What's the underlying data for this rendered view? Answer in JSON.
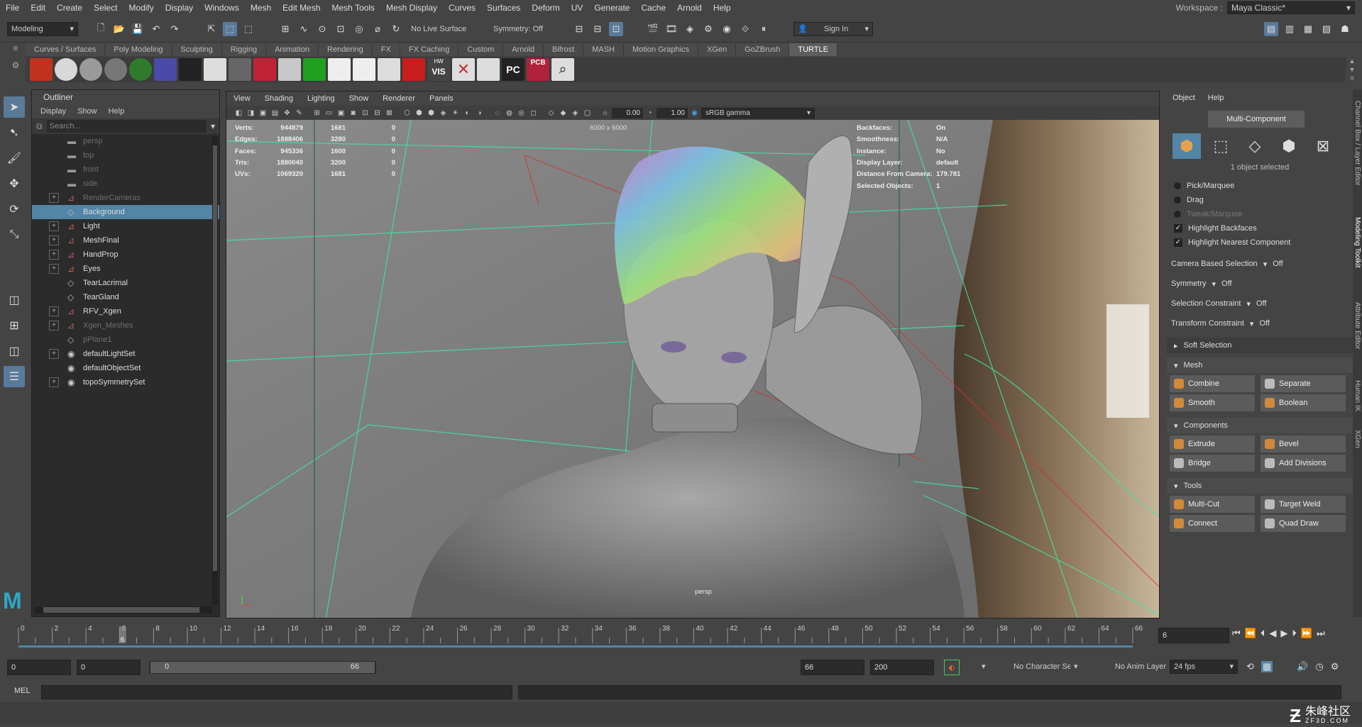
{
  "menubar": {
    "items": [
      "File",
      "Edit",
      "Create",
      "Select",
      "Modify",
      "Display",
      "Windows",
      "Mesh",
      "Edit Mesh",
      "Mesh Tools",
      "Mesh Display",
      "Curves",
      "Surfaces",
      "Deform",
      "UV",
      "Generate",
      "Cache",
      "Arnold",
      "Help"
    ]
  },
  "workspace": {
    "label": "Workspace :",
    "value": "Maya Classic*"
  },
  "statusline": {
    "mode": "Modeling",
    "live_surface": "No Live Surface",
    "symmetry": "Symmetry: Off",
    "sign_in": "Sign In"
  },
  "shelf": {
    "tabs": [
      "Curves / Surfaces",
      "Poly Modeling",
      "Sculpting",
      "Rigging",
      "Animation",
      "Rendering",
      "FX",
      "FX Caching",
      "Custom",
      "Arnold",
      "Bifrost",
      "MASH",
      "Motion Graphics",
      "XGen",
      "GoZBrush",
      "TURTLE"
    ],
    "active_tab": "TURTLE",
    "icons": [
      {
        "name": "fire",
        "color": "#c0321d"
      },
      {
        "name": "sphere-white",
        "color": "#d8d8d8"
      },
      {
        "name": "sphere-grey",
        "color": "#9a9a9a"
      },
      {
        "name": "sphere-dark",
        "color": "#777"
      },
      {
        "name": "sphere-green",
        "color": "#2e7b2e"
      },
      {
        "name": "grid-blue",
        "color": "#4a4aa8"
      },
      {
        "name": "dots",
        "color": "#222"
      },
      {
        "name": "molecule",
        "color": "#ddd"
      },
      {
        "name": "cylinder",
        "color": "#666"
      },
      {
        "name": "red-square",
        "color": "#c02236"
      },
      {
        "name": "red-cube",
        "color": "#c8c8c8"
      },
      {
        "name": "green-ball",
        "color": "#1fa01f"
      },
      {
        "name": "white-shapes",
        "color": "#eee"
      },
      {
        "name": "white-blob",
        "color": "#eee"
      },
      {
        "name": "lens",
        "color": "#ddd"
      },
      {
        "name": "red-eye",
        "color": "#c81e1e"
      },
      {
        "name": "hw-vis",
        "color": "#444"
      },
      {
        "name": "red-x",
        "color": "#d03030"
      },
      {
        "name": "bars",
        "color": "#ddd"
      },
      {
        "name": "pc",
        "color": "#222"
      },
      {
        "name": "pcb",
        "color": "#b0223a"
      },
      {
        "name": "magnifier",
        "color": "#ddd"
      }
    ],
    "hw_label": "HW",
    "vis_label": "VIS",
    "pc_label": "PC",
    "pcb_label": "PCB"
  },
  "outliner": {
    "title": "Outliner",
    "menu": [
      "Display",
      "Show",
      "Help"
    ],
    "search_placeholder": "Search...",
    "rows": [
      {
        "label": "persp",
        "exp": false,
        "icon": "camera",
        "dim": true,
        "sel": false
      },
      {
        "label": "top",
        "exp": false,
        "icon": "camera",
        "dim": true,
        "sel": false
      },
      {
        "label": "front",
        "exp": false,
        "icon": "camera",
        "dim": true,
        "sel": false
      },
      {
        "label": "side",
        "exp": false,
        "icon": "camera",
        "dim": true,
        "sel": false
      },
      {
        "label": "RenderCameras",
        "exp": true,
        "icon": "group",
        "dim": true,
        "sel": false
      },
      {
        "label": "Background",
        "exp": false,
        "icon": "mesh",
        "dim": false,
        "sel": true
      },
      {
        "label": "Light",
        "exp": true,
        "icon": "group",
        "dim": false,
        "sel": false
      },
      {
        "label": "MeshFinal",
        "exp": true,
        "icon": "group",
        "dim": false,
        "sel": false
      },
      {
        "label": "HandProp",
        "exp": true,
        "icon": "group",
        "dim": false,
        "sel": false
      },
      {
        "label": "Eyes",
        "exp": true,
        "icon": "group",
        "dim": false,
        "sel": false
      },
      {
        "label": "TearLacrimal",
        "exp": false,
        "icon": "mesh",
        "dim": false,
        "sel": false
      },
      {
        "label": "TearGland",
        "exp": false,
        "icon": "mesh",
        "dim": false,
        "sel": false
      },
      {
        "label": "RFV_Xgen",
        "exp": true,
        "icon": "group",
        "dim": false,
        "sel": false
      },
      {
        "label": "Xgen_Meshes",
        "exp": true,
        "icon": "group",
        "dim": true,
        "sel": false
      },
      {
        "label": "pPlane1",
        "exp": false,
        "icon": "mesh",
        "dim": true,
        "sel": false
      },
      {
        "label": "defaultLightSet",
        "exp": true,
        "icon": "set",
        "dim": false,
        "sel": false
      },
      {
        "label": "defaultObjectSet",
        "exp": false,
        "icon": "set",
        "dim": false,
        "sel": false
      },
      {
        "label": "topoSymmetrySet",
        "exp": true,
        "icon": "set",
        "dim": false,
        "sel": false
      }
    ]
  },
  "viewport": {
    "menu": [
      "View",
      "Shading",
      "Lighting",
      "Show",
      "Renderer",
      "Panels"
    ],
    "exposure": "0.00",
    "gamma": "1.00",
    "colorspace": "sRGB gamma",
    "resolution": "6000 x 6000",
    "camera": "persp",
    "stats": [
      {
        "label": "Verts:",
        "a": "944879",
        "b": "1681",
        "c": "0"
      },
      {
        "label": "Edges:",
        "a": "1888406",
        "b": "3280",
        "c": "0"
      },
      {
        "label": "Faces:",
        "a": "945336",
        "b": "1600",
        "c": "0"
      },
      {
        "label": "Tris:",
        "a": "1880040",
        "b": "3200",
        "c": "0"
      },
      {
        "label": "UVs:",
        "a": "1069320",
        "b": "1681",
        "c": "0"
      }
    ],
    "info": [
      {
        "label": "Backfaces:",
        "value": "On"
      },
      {
        "label": "Smoothness:",
        "value": "N/A"
      },
      {
        "label": "Instance:",
        "value": "No"
      },
      {
        "label": "Display Layer:",
        "value": "default"
      },
      {
        "label": "Distance From Camera:",
        "value": "179.781"
      },
      {
        "label": "Selected Objects:",
        "value": "1"
      }
    ]
  },
  "toolkit": {
    "menu": [
      "Object",
      "Help"
    ],
    "mode_button": "Multi-Component",
    "selected_text": "1 object selected",
    "radio": [
      {
        "label": "Pick/Marquee",
        "dim": false
      },
      {
        "label": "Drag",
        "dim": false
      },
      {
        "label": "Tweak/Marquee",
        "dim": true
      }
    ],
    "checks": [
      "Highlight Backfaces",
      "Highlight Nearest Component"
    ],
    "options": [
      {
        "label": "Camera Based Selection",
        "value": "Off"
      },
      {
        "label": "Symmetry",
        "value": "Off"
      },
      {
        "label": "Selection Constraint",
        "value": "Off"
      },
      {
        "label": "Transform Constraint",
        "value": "Off"
      }
    ],
    "soft_selection": "Soft Selection",
    "sections": [
      {
        "title": "Mesh",
        "buttons": [
          "Combine",
          "Separate",
          "Smooth",
          "Boolean"
        ]
      },
      {
        "title": "Components",
        "buttons": [
          "Extrude",
          "Bevel",
          "Bridge",
          "Add Divisions"
        ]
      },
      {
        "title": "Tools",
        "buttons": [
          "Multi-Cut",
          "Target Weld",
          "Connect",
          "Quad Draw"
        ]
      }
    ]
  },
  "side_tabs": [
    "Channel Box / Layer Editor",
    "Modeling Toolkit",
    "Attribute Editor",
    "Human IK",
    "XGen"
  ],
  "timeline": {
    "ticks": [
      "0",
      "2",
      "4",
      "6",
      "8",
      "10",
      "12",
      "14",
      "16",
      "18",
      "20",
      "22",
      "24",
      "26",
      "28",
      "30",
      "32",
      "34",
      "36",
      "38",
      "40",
      "42",
      "44",
      "46",
      "48",
      "50",
      "52",
      "54",
      "56",
      "58",
      "60",
      "62",
      "64",
      "66"
    ],
    "current_frame_value": 6,
    "last_frame_value": 66,
    "current_frame": "6"
  },
  "range": {
    "start": "0",
    "anim_start": "0",
    "slider_start": "0",
    "slider_end": "66",
    "end": "66",
    "anim_end": "200",
    "character_set": "No Character Set",
    "anim_layer": "No Anim Layer",
    "fps": "24 fps"
  },
  "cmd": {
    "lang": "MEL"
  },
  "watermark": {
    "cn": "朱峰社区",
    "url": "ZF3D.COM"
  }
}
